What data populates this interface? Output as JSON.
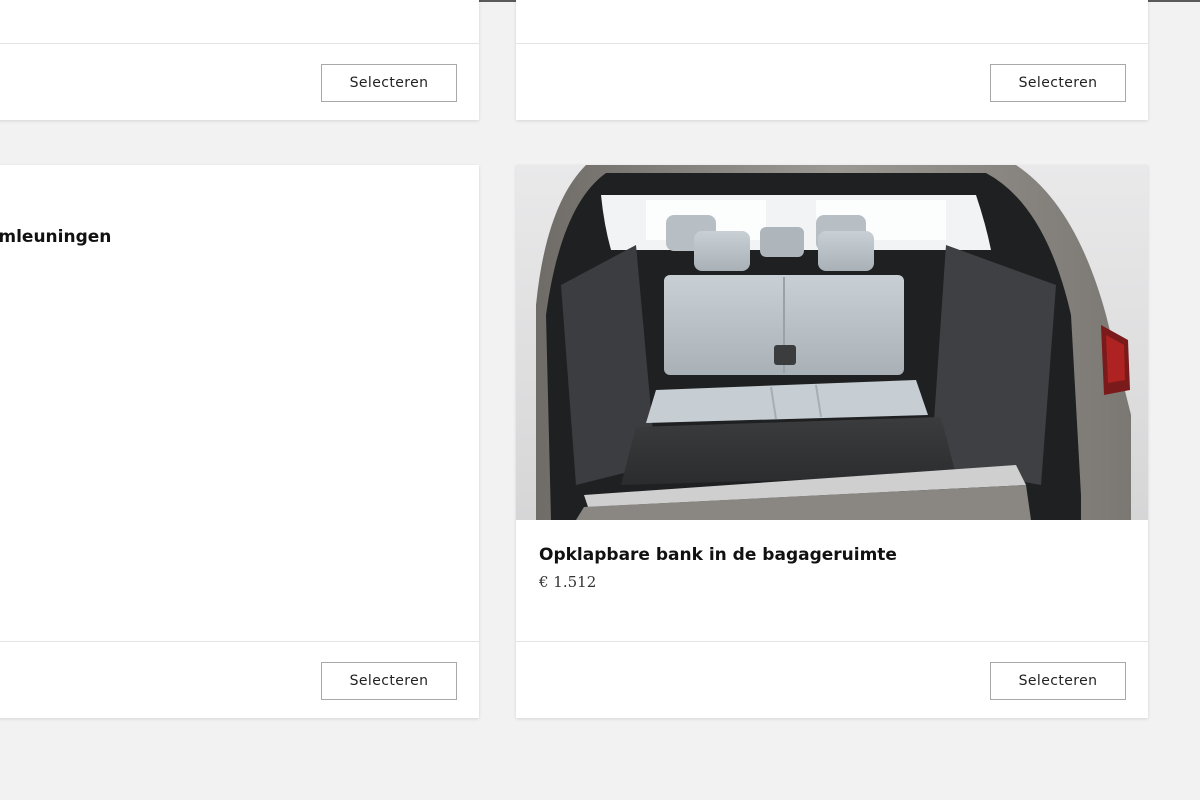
{
  "cards": [
    {
      "button_label": "Selecteren"
    },
    {
      "button_label": "Selecteren"
    },
    {
      "title": "rmleuningen",
      "button_label": "Selecteren"
    },
    {
      "title": "Opklapbare bank in de bagageruimte",
      "price": "€ 1.512",
      "image_icon": "car-trunk-image",
      "button_label": "Selecteren"
    }
  ],
  "colors": {
    "page_background": "#f2f2f2",
    "card_background": "#ffffff",
    "button_border": "#a8a8a8",
    "text_primary": "#111111"
  }
}
